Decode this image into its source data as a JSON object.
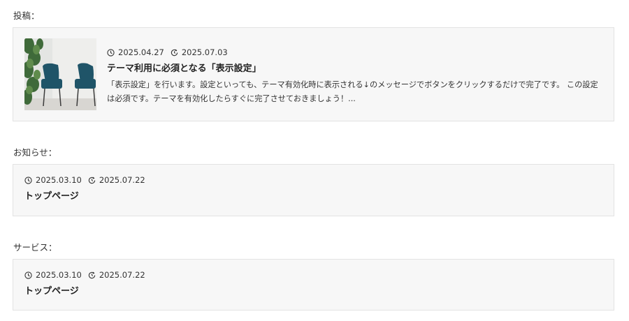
{
  "posts_section": {
    "label": "投稿：",
    "item": {
      "published": "2025.04.27",
      "modified": "2025.07.03",
      "title": "テーマ利用に必須となる「表示設定」",
      "excerpt": "「表示設定」を行います。設定といっても、テーマ有効化時に表示される↓のメッセージでボタンをクリックするだけで完了です。 この設定は必須です。テーマを有効化したらすぐに完了させておきましょう！..."
    }
  },
  "news_section": {
    "label": "お知らせ：",
    "item": {
      "published": "2025.03.10",
      "modified": "2025.07.22",
      "title": "トップページ"
    }
  },
  "services_section": {
    "label": "サービス：",
    "item": {
      "published": "2025.03.10",
      "modified": "2025.07.22",
      "title": "トップページ"
    }
  },
  "icons": {
    "published": "clock-icon",
    "modified": "refresh-clock-icon"
  }
}
